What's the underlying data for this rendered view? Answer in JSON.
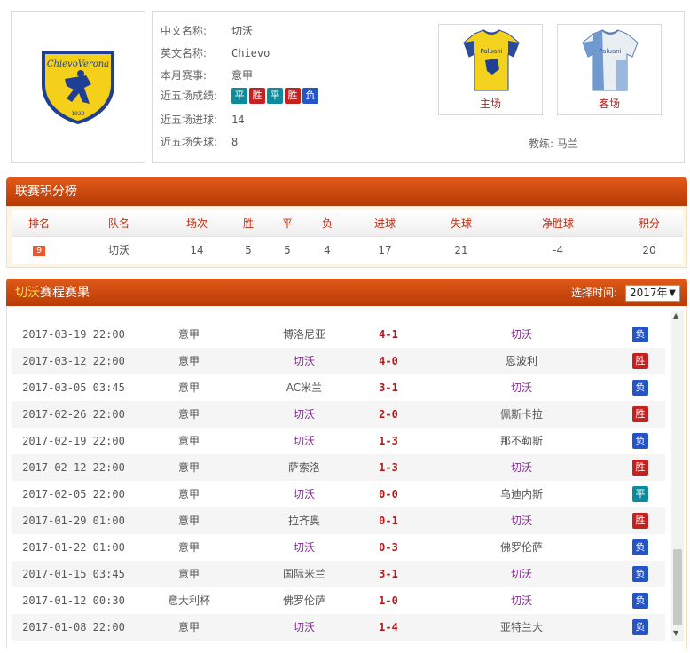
{
  "team": {
    "labels": {
      "cn_name": "中文名称:",
      "en_name": "英文名称:",
      "comp": "本月赛事:",
      "form": "近五场成绩:",
      "goals_for": "近五场进球:",
      "goals_against": "近五场失球:"
    },
    "cn_name": "切沃",
    "en_name": "Chievo",
    "comp": "意甲",
    "form": [
      "平",
      "胜",
      "平",
      "胜",
      "负"
    ],
    "goals_for": "14",
    "goals_against": "8",
    "logo_text": "ChievoVerona",
    "logo_year": "1929",
    "home_kit_label": "主场",
    "away_kit_label": "客场",
    "kit_sponsor": "Paluani",
    "coach_label": "教练:",
    "coach": "马兰"
  },
  "standings": {
    "title": "联赛积分榜",
    "headers": [
      "排名",
      "队名",
      "场次",
      "胜",
      "平",
      "负",
      "进球",
      "失球",
      "净胜球",
      "积分"
    ],
    "row": [
      "9",
      "切沃",
      "14",
      "5",
      "5",
      "4",
      "17",
      "21",
      "-4",
      "20"
    ]
  },
  "schedule": {
    "title_team": "切沃",
    "title_rest": "赛程赛果",
    "select_label": "选择时间:",
    "select_value": "2017年",
    "matches": [
      {
        "date": "2017-03-19 22:00",
        "comp": "意甲",
        "home": "博洛尼亚",
        "score": "4-1",
        "away": "切沃",
        "result": "负"
      },
      {
        "date": "2017-03-12 22:00",
        "comp": "意甲",
        "home": "切沃",
        "score": "4-0",
        "away": "恩波利",
        "result": "胜"
      },
      {
        "date": "2017-03-05 03:45",
        "comp": "意甲",
        "home": "AC米兰",
        "score": "3-1",
        "away": "切沃",
        "result": "负"
      },
      {
        "date": "2017-02-26 22:00",
        "comp": "意甲",
        "home": "切沃",
        "score": "2-0",
        "away": "佩斯卡拉",
        "result": "胜"
      },
      {
        "date": "2017-02-19 22:00",
        "comp": "意甲",
        "home": "切沃",
        "score": "1-3",
        "away": "那不勒斯",
        "result": "负"
      },
      {
        "date": "2017-02-12 22:00",
        "comp": "意甲",
        "home": "萨索洛",
        "score": "1-3",
        "away": "切沃",
        "result": "胜"
      },
      {
        "date": "2017-02-05 22:00",
        "comp": "意甲",
        "home": "切沃",
        "score": "0-0",
        "away": "乌迪内斯",
        "result": "平"
      },
      {
        "date": "2017-01-29 01:00",
        "comp": "意甲",
        "home": "拉齐奥",
        "score": "0-1",
        "away": "切沃",
        "result": "胜"
      },
      {
        "date": "2017-01-22 01:00",
        "comp": "意甲",
        "home": "切沃",
        "score": "0-3",
        "away": "佛罗伦萨",
        "result": "负"
      },
      {
        "date": "2017-01-15 03:45",
        "comp": "意甲",
        "home": "国际米兰",
        "score": "3-1",
        "away": "切沃",
        "result": "负"
      },
      {
        "date": "2017-01-12 00:30",
        "comp": "意大利杯",
        "home": "佛罗伦萨",
        "score": "1-0",
        "away": "切沃",
        "result": "负"
      },
      {
        "date": "2017-01-08 22:00",
        "comp": "意甲",
        "home": "切沃",
        "score": "1-4",
        "away": "亚特兰大",
        "result": "负"
      }
    ]
  }
}
